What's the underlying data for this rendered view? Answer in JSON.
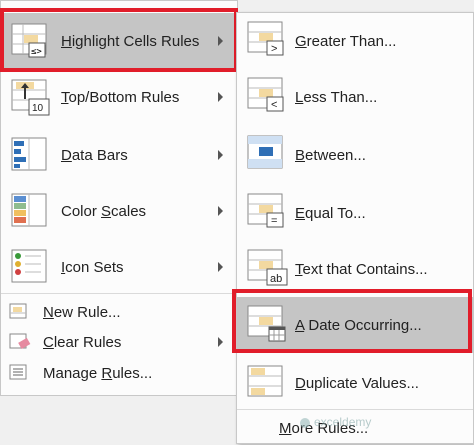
{
  "menu": {
    "items": [
      {
        "label": "Highlight Cells Rules",
        "mnemonic": "H",
        "icon": "highlight-cells-icon",
        "has_submenu": true
      },
      {
        "label": "Top/Bottom Rules",
        "mnemonic": "T",
        "icon": "top-bottom-icon",
        "has_submenu": true
      },
      {
        "label": "Data Bars",
        "mnemonic": "D",
        "icon": "data-bars-icon",
        "has_submenu": true
      },
      {
        "label": "Color Scales",
        "mnemonic": "S",
        "icon": "color-scales-icon",
        "has_submenu": true
      },
      {
        "label": "Icon Sets",
        "mnemonic": "I",
        "icon": "icon-sets-icon",
        "has_submenu": true
      },
      {
        "label": "New Rule...",
        "mnemonic": "N",
        "icon": "new-rule-icon",
        "has_submenu": false
      },
      {
        "label": "Clear Rules",
        "mnemonic": "C",
        "icon": "clear-rules-icon",
        "has_submenu": true
      },
      {
        "label": "Manage Rules...",
        "mnemonic": "R",
        "icon": "manage-rules-icon",
        "has_submenu": false
      }
    ],
    "top_bottom_icon_text": "10"
  },
  "submenu": {
    "items": [
      {
        "label": "Greater Than...",
        "mnemonic": "G",
        "icon_symbol": ">"
      },
      {
        "label": "Less Than...",
        "mnemonic": "L",
        "icon_symbol": "<"
      },
      {
        "label": "Between...",
        "mnemonic": "B",
        "icon_symbol": ""
      },
      {
        "label": "Equal To...",
        "mnemonic": "E",
        "icon_symbol": "="
      },
      {
        "label": "Text that Contains...",
        "mnemonic": "T",
        "icon_symbol": "ab"
      },
      {
        "label": "A Date Occurring...",
        "mnemonic": "A",
        "icon_symbol": ""
      },
      {
        "label": "Duplicate Values...",
        "mnemonic": "D",
        "icon_symbol": ""
      },
      {
        "label": "More Rules...",
        "mnemonic": "M",
        "icon_symbol": ""
      }
    ]
  },
  "watermark": "exceldemy",
  "colors": {
    "highlight": "#c5c5c5",
    "red_box": "#e11d2a",
    "cell_yellow": "#f3d9a0",
    "blue": "#2f6fb6"
  }
}
